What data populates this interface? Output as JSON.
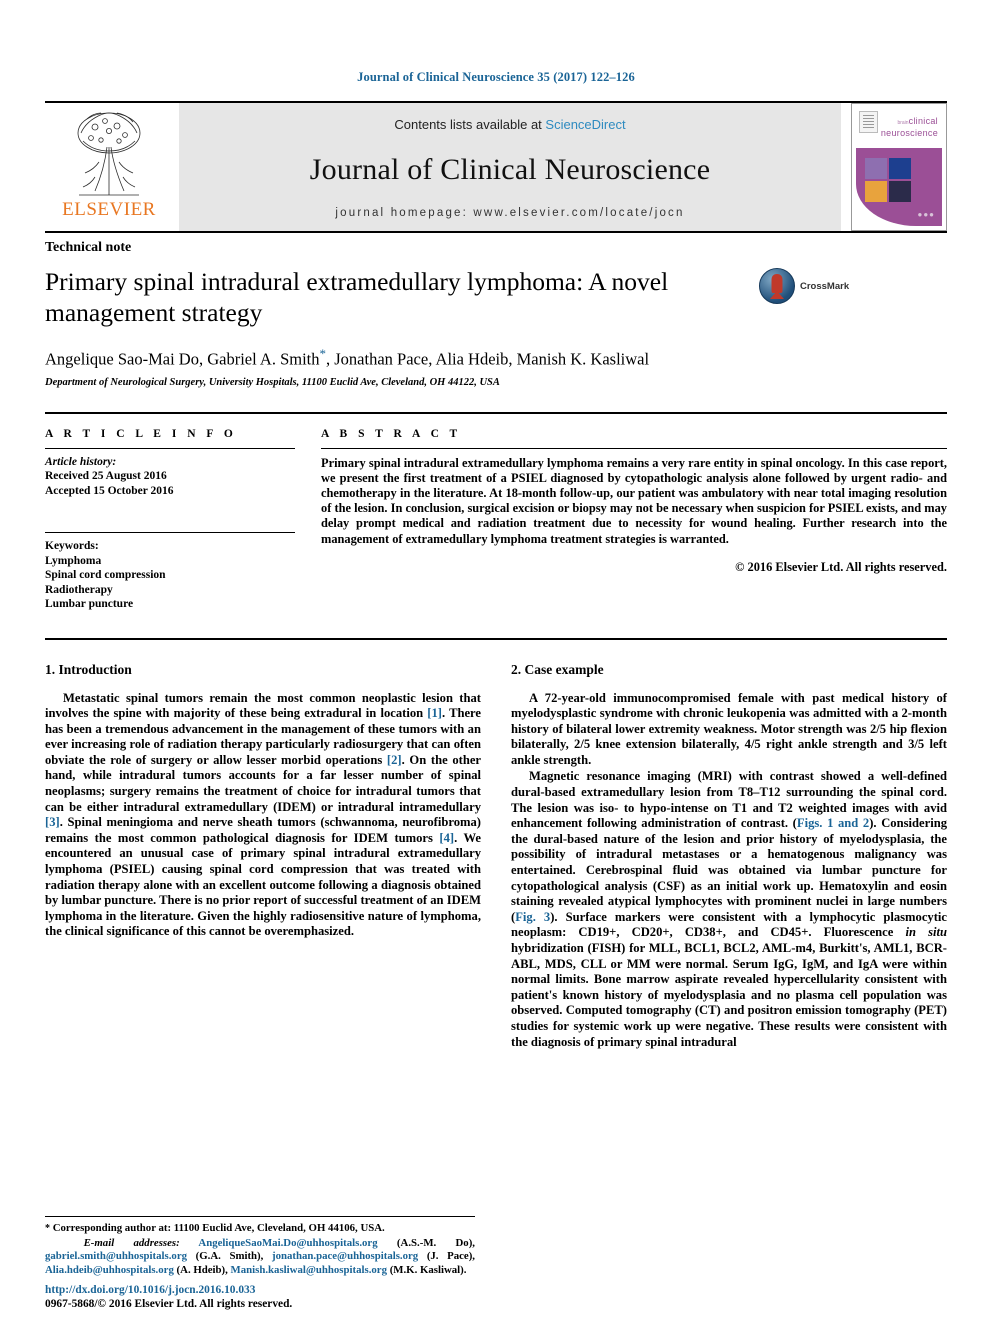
{
  "running_head": "Journal of Clinical Neuroscience 35 (2017) 122–126",
  "masthead": {
    "publisher": "ELSEVIER",
    "contents_prefix": "Contents lists available at ",
    "contents_link": "ScienceDirect",
    "journal_title": "Journal of Clinical Neuroscience",
    "homepage": "journal homepage: www.elsevier.com/locate/jocn",
    "cover": {
      "brand_small": "brain",
      "brand_line1": "clinical",
      "brand_line2": "neuroscience",
      "tile_colors": [
        "#8e6fb0",
        "#1d3f8f",
        "#e8a33d",
        "#2b2b4a"
      ],
      "arc_color": "#9b4f96"
    }
  },
  "article": {
    "type": "Technical note",
    "title": "Primary spinal intradural extramedullary lymphoma: A novel management strategy",
    "authors_pre": "Angelique Sao-Mai Do, Gabriel A. Smith",
    "authors_star": "*",
    "authors_post": ", Jonathan Pace, Alia Hdeib, Manish K. Kasliwal",
    "affiliation": "Department of Neurological Surgery, University Hospitals, 11100 Euclid Ave, Cleveland, OH 44122, USA",
    "crossmark_label": "CrossMark"
  },
  "article_info": {
    "heading": "A R T I C L E   I N F O",
    "history_label": "Article history:",
    "received": "Received 25 August 2016",
    "accepted": "Accepted 15 October 2016",
    "keywords_label": "Keywords:",
    "keywords": [
      "Lymphoma",
      "Spinal cord compression",
      "Radiotherapy",
      "Lumbar puncture"
    ]
  },
  "abstract": {
    "heading": "A B S T R A C T",
    "text": "Primary spinal intradural extramedullary lymphoma remains a very rare entity in spinal oncology. In this case report, we present the first treatment of a PSIEL diagnosed by cytopathologic analysis alone followed by urgent radio- and chemotherapy in the literature. At 18-month follow-up, our patient was ambulatory with near total imaging resolution of the lesion. In conclusion, surgical excision or biopsy may not be necessary when suspicion for PSIEL exists, and may delay prompt medical and radiation treatment due to necessity for wound healing. Further research into the management of extramedullary lymphoma treatment strategies is warranted.",
    "copyright": "© 2016 Elsevier Ltd. All rights reserved."
  },
  "sections": {
    "intro": {
      "heading": "1. Introduction",
      "p1_a": "Metastatic spinal tumors remain the most common neoplastic lesion that involves the spine with majority of these being extradural in location ",
      "ref1": "[1]",
      "p1_b": ". There has been a tremendous advancement in the management of these tumors with an ever increasing role of radiation therapy particularly radiosurgery that can often obviate the role of surgery or allow lesser morbid operations ",
      "ref2": "[2]",
      "p1_c": ". On the other hand, while intradural tumors accounts for a far lesser number of spinal neoplasms; surgery remains the treatment of choice for intradural tumors that can be either intradural extramedullary (IDEM) or intradural intramedullary ",
      "ref3": "[3]",
      "p1_d": ". Spinal meningioma and nerve sheath tumors (schwannoma, neurofibroma) remains the most common pathological diagnosis for IDEM tumors ",
      "ref4": "[4]",
      "p1_e": ". We encountered an unusual case of primary spinal intradural extramedullary lymphoma (PSIEL) causing spinal cord compression that was treated with radiation therapy alone with an excellent outcome following a diagnosis obtained by lumbar puncture. There is no prior report of successful treatment of an IDEM lymphoma in the literature. Given the highly radiosensitive nature of lymphoma, the clinical significance of this cannot be overemphasized."
    },
    "case": {
      "heading": "2. Case example",
      "p1": "A 72-year-old immunocompromised female with past medical history of myelodysplastic syndrome with chronic leukopenia was admitted with a 2-month history of bilateral lower extremity weakness. Motor strength was 2/5 hip flexion bilaterally, 2/5 knee extension bilaterally, 4/5 right ankle strength and 3/5 left ankle strength.",
      "p2_a": "Magnetic resonance imaging (MRI) with contrast showed a well-defined dural-based extramedullary lesion from T8–T12 surrounding the spinal cord. The lesion was iso- to hypo-intense on T1 and T2 weighted images with avid enhancement following administration of contrast. (",
      "fig_link_12": "Figs. 1 and 2",
      "p2_b": "). Considering the dural-based nature of the lesion and prior history of myelodysplasia, the possibility of intradural metastases or a hematogenous malignancy was entertained. Cerebrospinal fluid was obtained via lumbar puncture for cytopathological analysis (CSF) as an initial work up. Hematoxylin and eosin staining revealed atypical lymphocytes with prominent nuclei in large numbers (",
      "fig_link_3": "Fig. 3",
      "p2_c": "). Surface markers were consistent with a lymphocytic plasmocytic neoplasm: CD19+, CD20+, CD38+, and CD45+. Fluorescence ",
      "p2_italic": "in situ",
      "p2_d": " hybridization (FISH) for MLL, BCL1, BCL2, AML-m4, Burkitt's, AML1, BCR-ABL, MDS, CLL or MM were normal. Serum IgG, IgM, and IgA were within normal limits. Bone marrow aspirate revealed hypercellularity consistent with patient's known history of myelodysplasia and no plasma cell population was observed. Computed tomography (CT) and positron emission tomography (PET) studies for systemic work up were negative. These results were consistent with the diagnosis of primary spinal intradural"
    }
  },
  "footnotes": {
    "corresponding_star": "*",
    "corresponding": " Corresponding author at: 11100 Euclid Ave, Cleveland, OH 44106, USA.",
    "emails_label": "E-mail addresses:",
    "emails": [
      {
        "address": "AngeliqueSaoMai.Do@uhhospitals.org",
        "name": " (A.S.-M. Do), "
      },
      {
        "address": "gabriel.smith@uhhospitals.org",
        "name": " (G.A. Smith), "
      },
      {
        "address": "jonathan.pace@uhhospitals.org",
        "name": " (J. Pace), "
      },
      {
        "address": "Alia.hdeib@uhhospitals.org",
        "name": " (A. Hdeib), "
      },
      {
        "address": "Manish.kasliwal@uhhospitals.org",
        "name": " (M.K. Kasliwal)."
      }
    ],
    "doi": "http://dx.doi.org/10.1016/j.jocn.2016.10.033",
    "issn": "0967-5868/© 2016 Elsevier Ltd. All rights reserved."
  }
}
